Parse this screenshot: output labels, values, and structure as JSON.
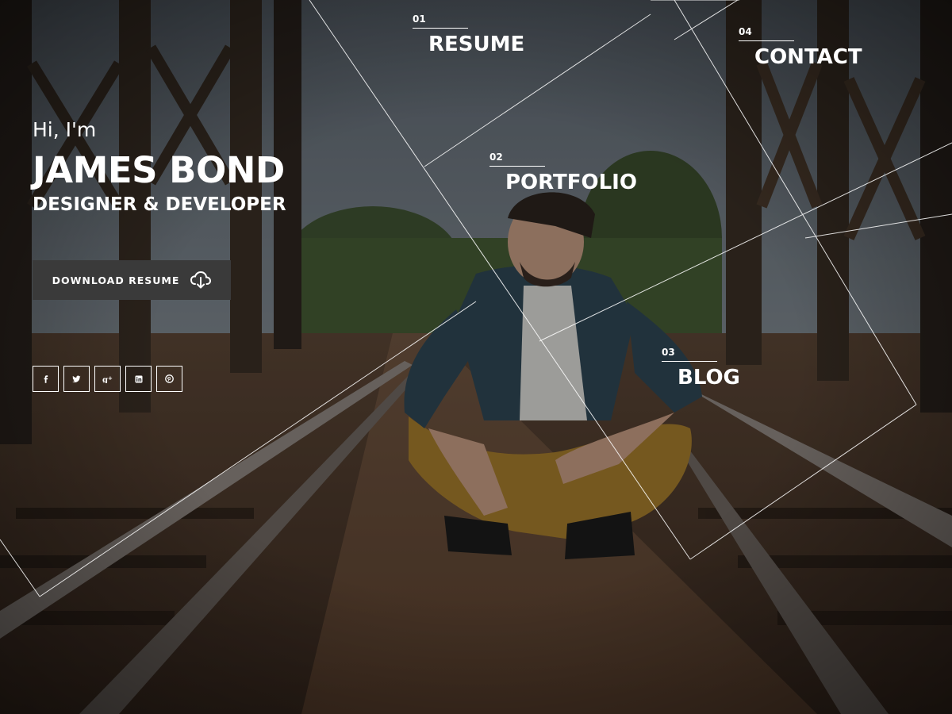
{
  "intro": {
    "greeting": "Hi, I'm",
    "name": "JAMES BOND",
    "tagline": "DESIGNER & DEVELOPER"
  },
  "download": {
    "label": "DOWNLOAD RESUME",
    "icon": "cloud-download-icon"
  },
  "socials": [
    {
      "name": "facebook",
      "icon": "facebook-icon"
    },
    {
      "name": "twitter",
      "icon": "twitter-icon"
    },
    {
      "name": "google-plus",
      "icon": "google-plus-icon"
    },
    {
      "name": "linkedin",
      "icon": "linkedin-icon"
    },
    {
      "name": "pinterest",
      "icon": "pinterest-icon"
    }
  ],
  "nav": [
    {
      "number": "01",
      "label": "RESUME"
    },
    {
      "number": "02",
      "label": "PORTFOLIO"
    },
    {
      "number": "03",
      "label": "BLOG"
    },
    {
      "number": "04",
      "label": "CONTACT"
    }
  ],
  "colors": {
    "overlay": "#000000",
    "text": "#ffffff",
    "button_bg": "#3a3a3a"
  }
}
